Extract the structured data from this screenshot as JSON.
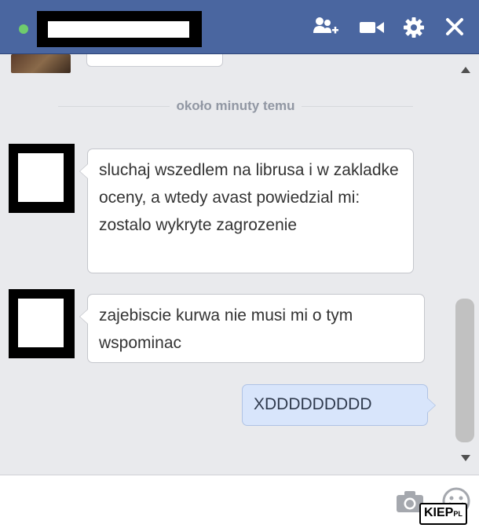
{
  "header": {
    "contact_name": "",
    "icons": [
      "add-friend-icon",
      "video-call-icon",
      "gear-icon",
      "close-icon"
    ],
    "colors": {
      "bar": "#4a66a0",
      "online": "#6fcc6d"
    }
  },
  "conversation": {
    "time_divider": "około minuty temu",
    "messages": [
      {
        "from": "them",
        "text": "sluchaj wszedlem na librusa i w zakladke oceny, a wtedy avast powiedzial mi: zostalo wykryte zagrozenie"
      },
      {
        "from": "them",
        "text": "zajebiscie kurwa nie musi mi o tym wspominac"
      },
      {
        "from": "me",
        "text": "XDDDDDDDDD"
      }
    ]
  },
  "composer": {
    "value": "",
    "icons": [
      "camera-icon",
      "emoji-icon"
    ]
  },
  "watermark": {
    "text": "KIEP",
    "suffix": "PL"
  }
}
